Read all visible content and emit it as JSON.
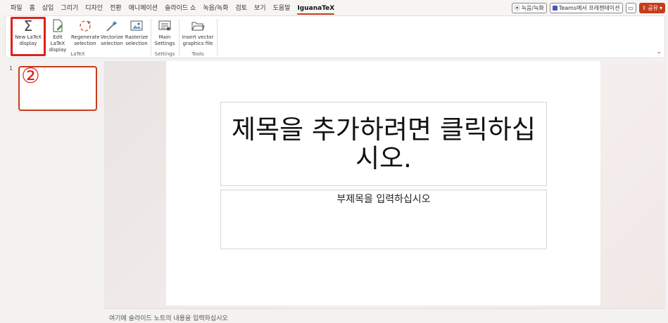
{
  "menu": {
    "tabs": [
      "파일",
      "홈",
      "삽입",
      "그리기",
      "디자인",
      "전환",
      "애니메이션",
      "슬라이드 쇼",
      "녹음/녹화",
      "검토",
      "보기",
      "도움말",
      "IguanaTeX"
    ],
    "active_tab": "IguanaTeX"
  },
  "top_right": {
    "record_label": "녹음/녹화",
    "teams_label": "Teams에서 프레젠테이션",
    "share_label": "공유"
  },
  "ribbon": {
    "latex_group": {
      "label": "LaTeX",
      "buttons": {
        "new_latex_display": "New LaTeX display",
        "edit_latex_display": "Edit LaTeX display",
        "regenerate_selection": "Regenerate selection",
        "vectorize_selection": "Vectorize selection",
        "rasterize_selection": "Rasterize selection"
      }
    },
    "settings_group": {
      "label": "Settings",
      "buttons": {
        "main_settings": "Main Settings"
      }
    },
    "tools_group": {
      "label": "Tools",
      "buttons": {
        "insert_vector_graphics": "Insert vector graphics file"
      }
    }
  },
  "slides_panel": {
    "slide_number": "1",
    "annotation": "②"
  },
  "slide": {
    "title_placeholder": "제목을 추가하려면 클릭하십시오.",
    "subtitle_placeholder": "부제목을 입력하십시오"
  },
  "notes": {
    "placeholder": "여기에 슬라이드 노트의 내용을 입력하십시오"
  },
  "colors": {
    "accent": "#c43e1c",
    "highlight_red": "#e0201b"
  }
}
